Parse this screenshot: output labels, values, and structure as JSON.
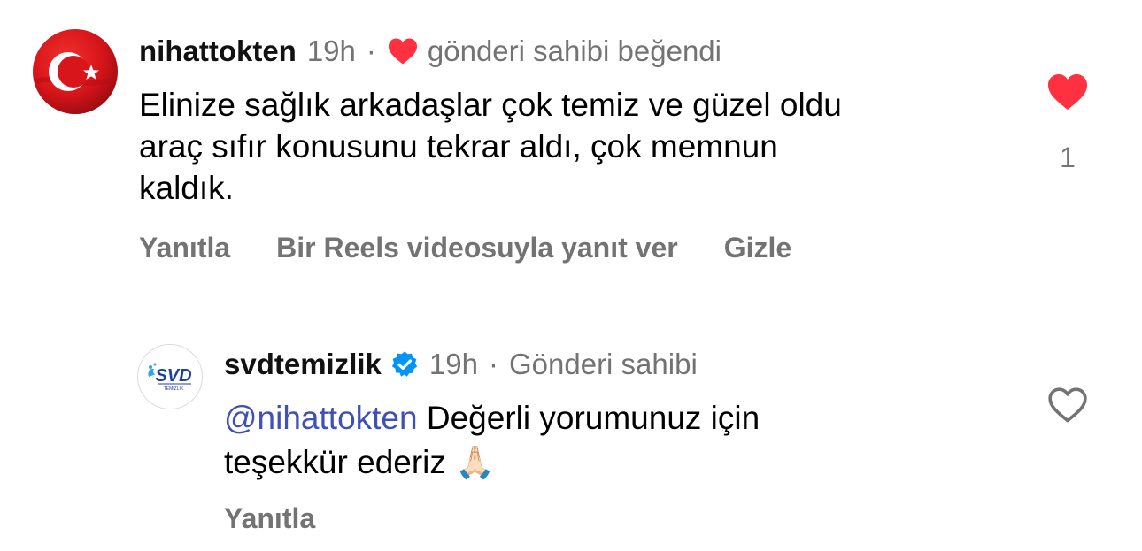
{
  "comment": {
    "username": "nihattokten",
    "time": "19h",
    "separator": "·",
    "liked_by_author": "gönderi sahibi beğendi",
    "text_line1": "Elinize sağlık arkadaşlar çok temiz ve güzel oldu",
    "text_line2": "araç sıfır konusunu tekrar aldı, çok memnun",
    "text_line3": "kaldık.",
    "like_count": "1",
    "actions": {
      "reply": "Yanıtla",
      "reels_reply": "Bir Reels videosuyla yanıt ver",
      "hide": "Gizle"
    },
    "avatar": "turkish-flag-avatar"
  },
  "reply": {
    "username": "svdtemizlik",
    "verified": true,
    "time": "19h",
    "separator": "·",
    "author_label": "Gönderi sahibi",
    "mention": "@nihattokten",
    "text_line1_rest": " Değerli yorumunuz için",
    "text_line2": "teşekkür ederiz",
    "emoji": "🙏🏻",
    "actions": {
      "reply": "Yanıtla"
    },
    "avatar": "svd-logo-avatar"
  },
  "colors": {
    "like_red": "#ff3040",
    "muted": "#737373",
    "mention": "#3f51b5",
    "verified_blue": "#0095f6"
  }
}
